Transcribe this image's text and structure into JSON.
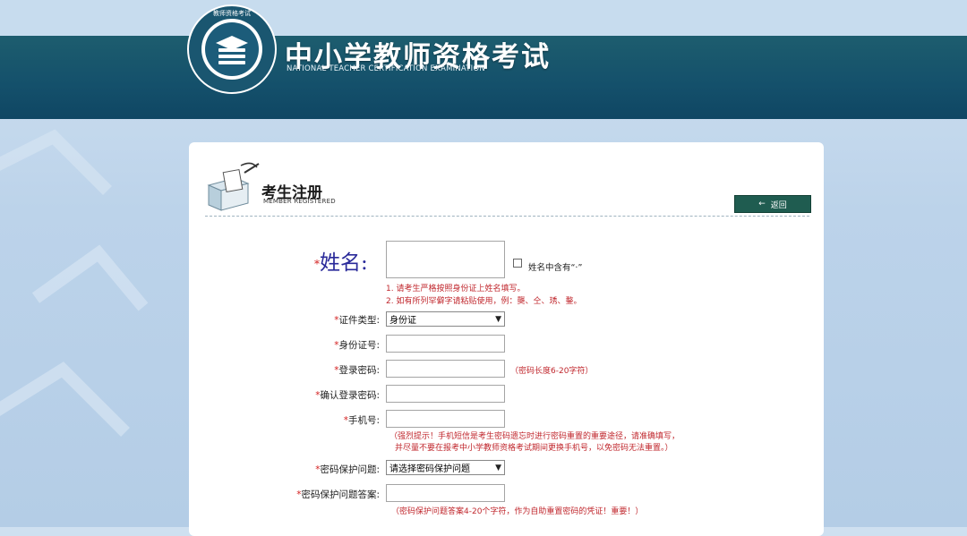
{
  "site": {
    "title": "中小学教师资格考试",
    "subtitle": "NATIONAL TEACHER CERTIFICATION EXAMINATION",
    "logo_text": "教师资格考试",
    "logo_ring_text": "National Teacher Certification Examination"
  },
  "page": {
    "title": "考生注册",
    "subtitle": "MEMBER REGISTERED",
    "back_label": "返回"
  },
  "form": {
    "required_mark": "*",
    "name": {
      "label": "姓名:",
      "value": "",
      "dot_checkbox_label": "姓名中含有“·”",
      "dot_checked": false,
      "hint1": "1. 请考生严格按照身份证上姓名填写。",
      "hint2": "2. 如有所列罕僻字请粘贴使用，例：龑、仝、琇、鍪。"
    },
    "id_type": {
      "label": "证件类型:",
      "selected": "身份证"
    },
    "id_number": {
      "label": "身份证号:",
      "value": ""
    },
    "password": {
      "label": "登录密码:",
      "value": "",
      "hint": "（密码长度6-20字符）"
    },
    "confirm_password": {
      "label": "确认登录密码:",
      "value": ""
    },
    "phone": {
      "label": "手机号:",
      "value": "",
      "hint1": "（强烈提示！手机短信是考生密码遗忘时进行密码重置的重要途径，请准确填写，",
      "hint2": "并尽量不要在报考中小学教师资格考试期间更换手机号，以免密码无法重置。）"
    },
    "security_question": {
      "label": "密码保护问题:",
      "selected": "请选择密码保护问题"
    },
    "security_answer": {
      "label": "密码保护问题答案:",
      "value": "",
      "hint": "（密码保护问题答案4-20个字符，作为自助重置密码的凭证！重要！）"
    }
  },
  "colors": {
    "banner": "#14506b",
    "accent_red": "#c0272d",
    "back_button": "#1f5c50"
  }
}
